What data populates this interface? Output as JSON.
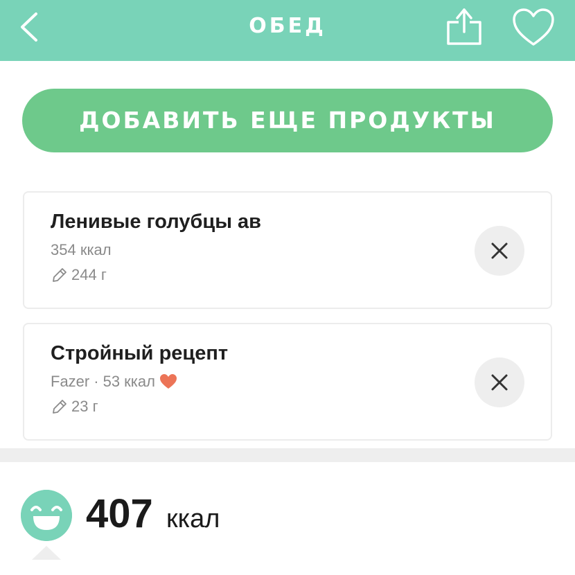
{
  "header": {
    "title": "ОБЕД",
    "back_icon": "chevron-left-icon",
    "share_icon": "share-icon",
    "favorite_icon": "heart-outline-icon",
    "background": "#79d3b8"
  },
  "add_button": {
    "label": "ДОБАВИТЬ ЕЩЕ ПРОДУКТЫ",
    "color": "#6ec98b"
  },
  "items": [
    {
      "name": "Ленивые голубцы ав",
      "calories": "354 ккал",
      "weight": "244 г"
    },
    {
      "name": "Стройный рецепт",
      "brand": "Fazer",
      "separator": "·",
      "calories": "53 ккал",
      "favorite": true,
      "weight": "23 г"
    }
  ],
  "summary": {
    "value": "407",
    "unit": "ккал",
    "icon": "smiley-icon"
  },
  "colors": {
    "accent": "#79d3b8",
    "button": "#6ec98b",
    "heart": "#ec7457"
  }
}
